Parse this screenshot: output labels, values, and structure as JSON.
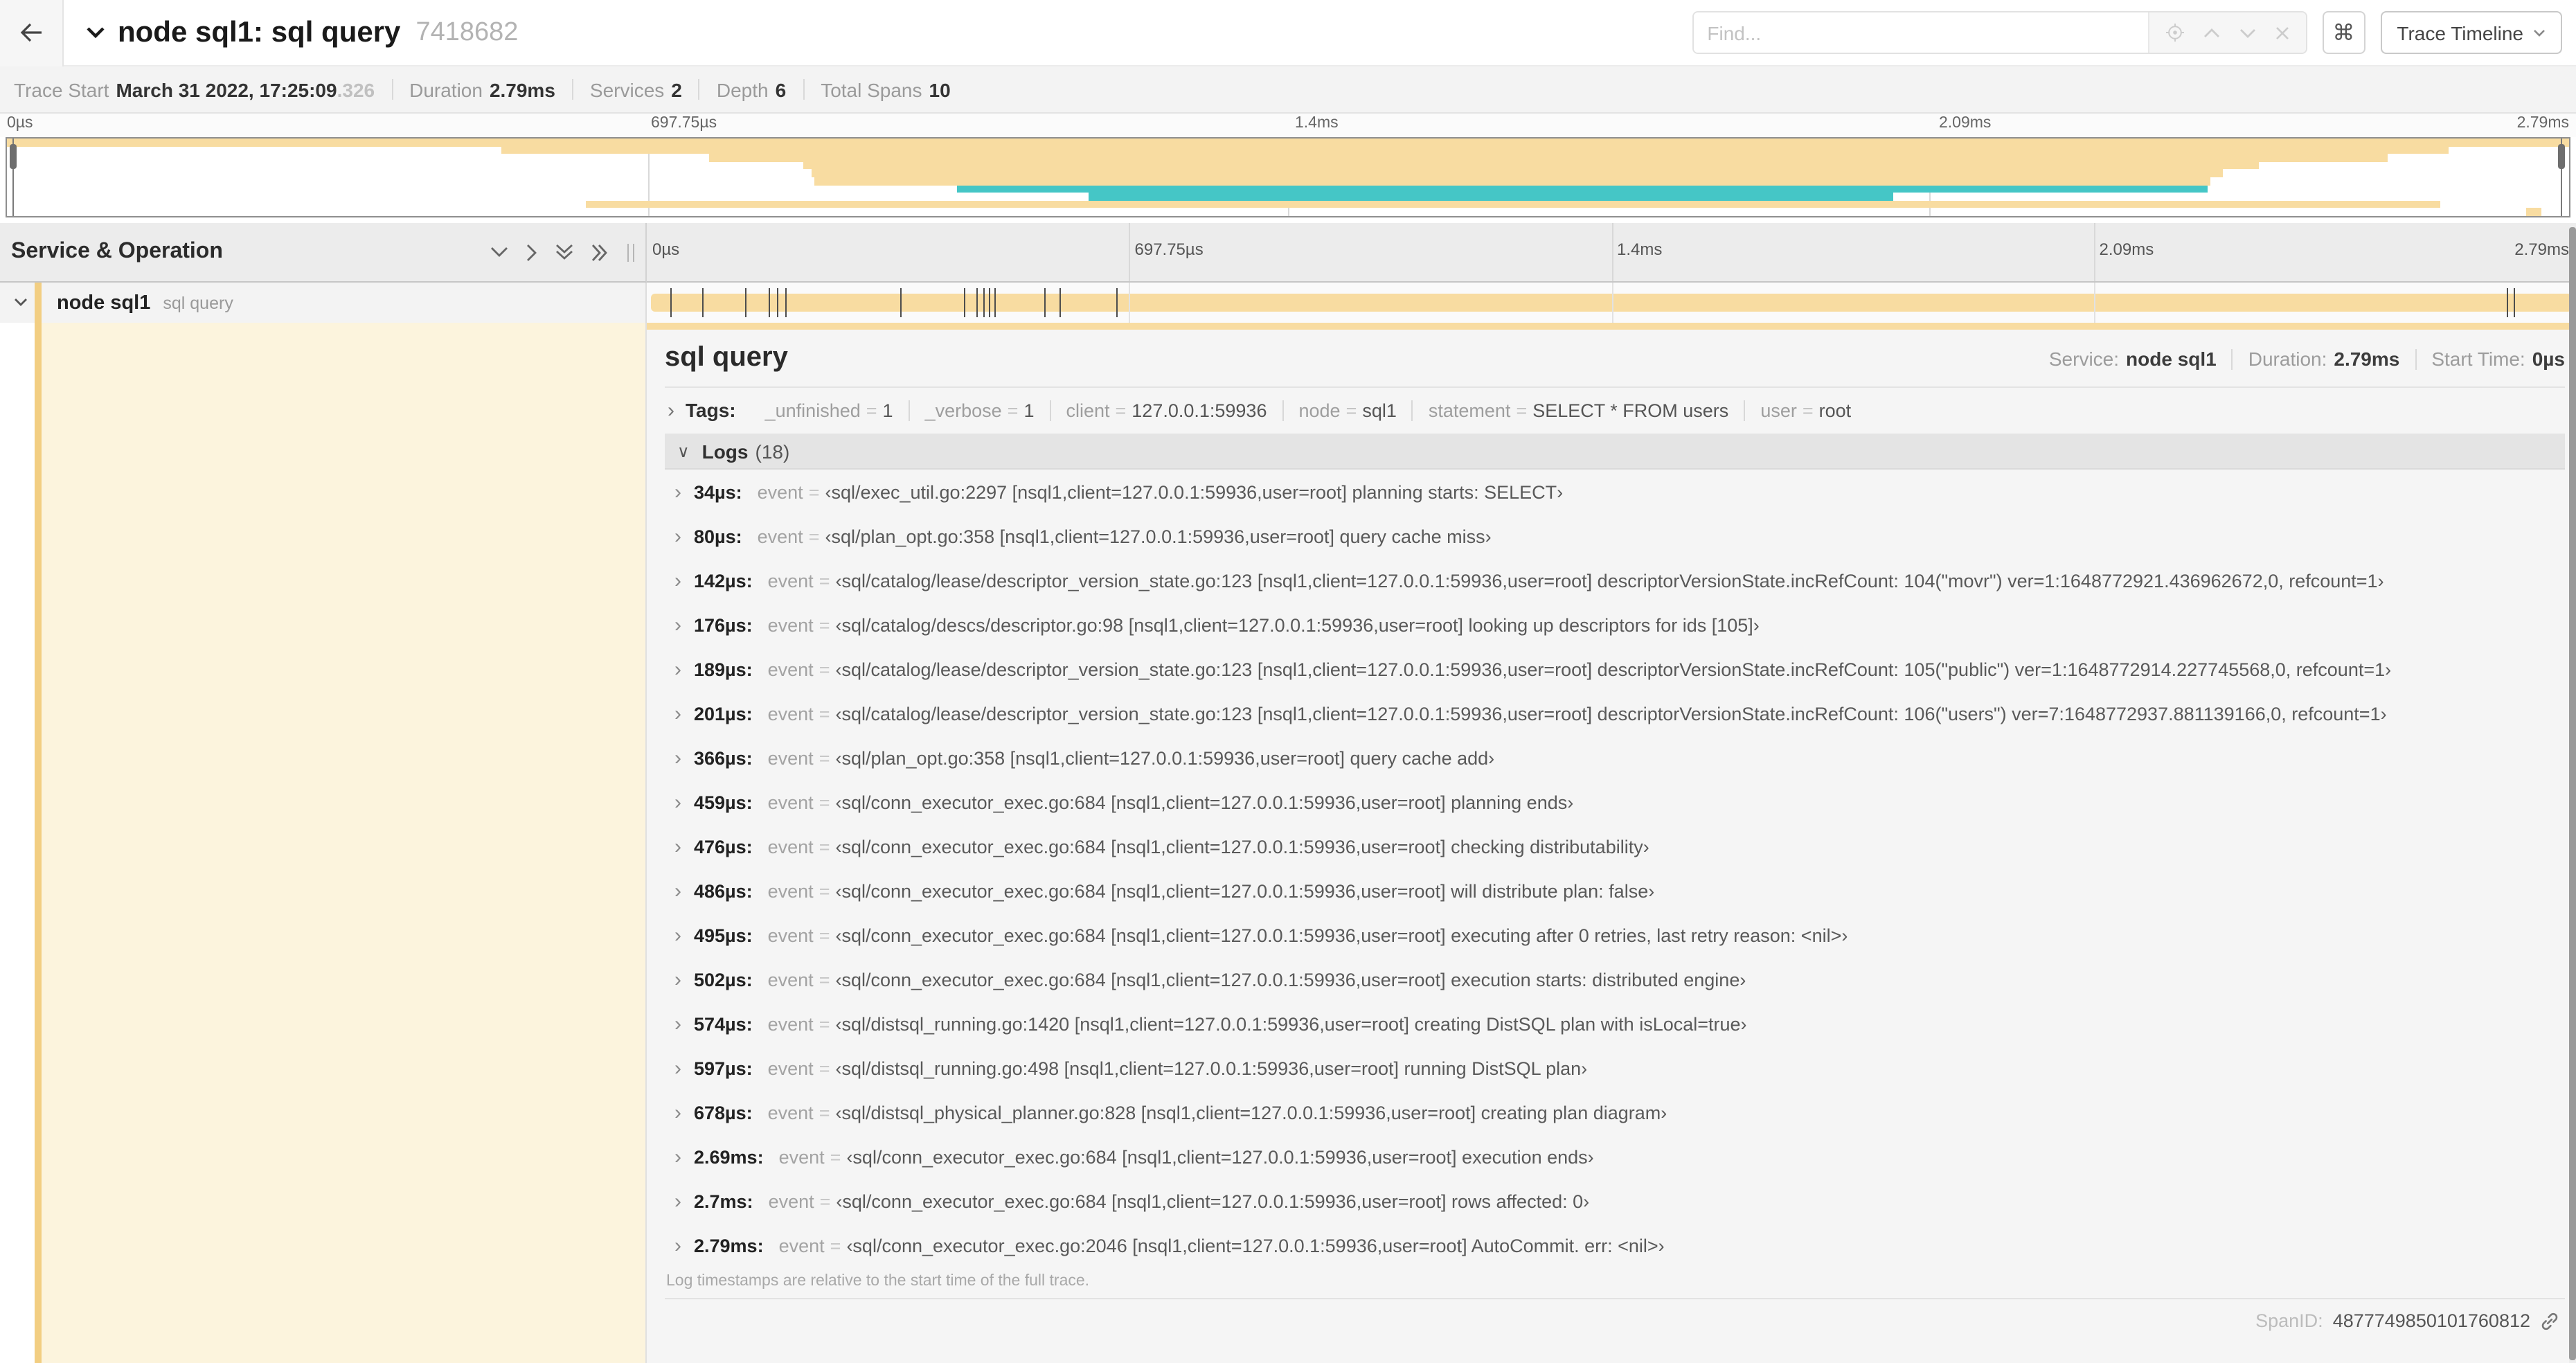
{
  "header": {
    "title": "node sql1: sql query",
    "trace_id_short": "7418682",
    "find_placeholder": "Find...",
    "view_selector": "Trace Timeline",
    "shortcut_key": "⌘"
  },
  "trace_info": {
    "items": [
      {
        "label": "Trace Start",
        "value": "March 31 2022, 17:25:09",
        "suffix": ".326"
      },
      {
        "label": "Duration",
        "value": "2.79ms"
      },
      {
        "label": "Services",
        "value": "2"
      },
      {
        "label": "Depth",
        "value": "6"
      },
      {
        "label": "Total Spans",
        "value": "10"
      }
    ]
  },
  "minimap": {
    "palette": {
      "orange": "#f8dca1",
      "teal": "#45c6c6"
    },
    "spans": [
      {
        "s": 0,
        "e": 100,
        "c": "orange"
      },
      {
        "s": 19.3,
        "e": 95.3,
        "c": "orange"
      },
      {
        "s": 27.4,
        "e": 92.9,
        "c": "orange"
      },
      {
        "s": 31.1,
        "e": 87.9,
        "c": "orange"
      },
      {
        "s": 31.4,
        "e": 86.5,
        "c": "orange"
      },
      {
        "s": 31.5,
        "e": 86.0,
        "c": "orange"
      },
      {
        "s": 37.1,
        "e": 85.9,
        "c": "teal"
      },
      {
        "s": 42.2,
        "e": 73.6,
        "c": "teal"
      },
      {
        "s": 22.6,
        "e": 95.0,
        "c": "orange"
      },
      {
        "s": 98.3,
        "e": 98.9,
        "c": "orange"
      }
    ]
  },
  "timeline": {
    "left_header": "Service & Operation",
    "ticks": [
      {
        "label": "0µs",
        "pos": 0
      },
      {
        "label": "697.75µs",
        "pos": 25
      },
      {
        "label": "1.4ms",
        "pos": 50
      },
      {
        "label": "2.09ms",
        "pos": 75
      },
      {
        "label": "2.79ms",
        "pos": 100
      }
    ],
    "gridline_positions": [
      25,
      50,
      75
    ],
    "row": {
      "service": "node sql1",
      "operation": "sql query"
    },
    "duration_us": 2790,
    "log_marker_times_us": [
      34,
      80,
      142,
      176,
      189,
      201,
      366,
      459,
      476,
      486,
      495,
      502,
      574,
      597,
      678,
      2690,
      2700
    ]
  },
  "detail": {
    "title": "sql query",
    "meta": [
      {
        "label": "Service:",
        "value": "node sql1"
      },
      {
        "label": "Duration:",
        "value": "2.79ms"
      },
      {
        "label": "Start Time:",
        "value": "0µs"
      }
    ],
    "tags_label": "Tags:",
    "tags": [
      {
        "key": "_unfinished",
        "value": "1"
      },
      {
        "key": "_verbose",
        "value": "1"
      },
      {
        "key": "client",
        "value": "127.0.0.1:59936"
      },
      {
        "key": "node",
        "value": "sql1"
      },
      {
        "key": "statement",
        "value": "SELECT * FROM users"
      },
      {
        "key": "user",
        "value": "root"
      }
    ],
    "logs_label": "Logs",
    "logs_count": "(18)",
    "logs": [
      {
        "time": "34µs:",
        "key": "event",
        "value": "‹sql/exec_util.go:2297 [nsql1,client=127.0.0.1:59936,user=root] planning starts: SELECT›"
      },
      {
        "time": "80µs:",
        "key": "event",
        "value": "‹sql/plan_opt.go:358 [nsql1,client=127.0.0.1:59936,user=root] query cache miss›"
      },
      {
        "time": "142µs:",
        "key": "event",
        "value": "‹sql/catalog/lease/descriptor_version_state.go:123 [nsql1,client=127.0.0.1:59936,user=root] descriptorVersionState.incRefCount: 104(\"movr\") ver=1:1648772921.436962672,0, refcount=1›"
      },
      {
        "time": "176µs:",
        "key": "event",
        "value": "‹sql/catalog/descs/descriptor.go:98 [nsql1,client=127.0.0.1:59936,user=root] looking up descriptors for ids [105]›"
      },
      {
        "time": "189µs:",
        "key": "event",
        "value": "‹sql/catalog/lease/descriptor_version_state.go:123 [nsql1,client=127.0.0.1:59936,user=root] descriptorVersionState.incRefCount: 105(\"public\") ver=1:1648772914.227745568,0, refcount=1›"
      },
      {
        "time": "201µs:",
        "key": "event",
        "value": "‹sql/catalog/lease/descriptor_version_state.go:123 [nsql1,client=127.0.0.1:59936,user=root] descriptorVersionState.incRefCount: 106(\"users\") ver=7:1648772937.881139166,0, refcount=1›"
      },
      {
        "time": "366µs:",
        "key": "event",
        "value": "‹sql/plan_opt.go:358 [nsql1,client=127.0.0.1:59936,user=root] query cache add›"
      },
      {
        "time": "459µs:",
        "key": "event",
        "value": "‹sql/conn_executor_exec.go:684 [nsql1,client=127.0.0.1:59936,user=root] planning ends›"
      },
      {
        "time": "476µs:",
        "key": "event",
        "value": "‹sql/conn_executor_exec.go:684 [nsql1,client=127.0.0.1:59936,user=root] checking distributability›"
      },
      {
        "time": "486µs:",
        "key": "event",
        "value": "‹sql/conn_executor_exec.go:684 [nsql1,client=127.0.0.1:59936,user=root] will distribute plan: false›"
      },
      {
        "time": "495µs:",
        "key": "event",
        "value": "‹sql/conn_executor_exec.go:684 [nsql1,client=127.0.0.1:59936,user=root] executing after 0 retries, last retry reason: <nil>›"
      },
      {
        "time": "502µs:",
        "key": "event",
        "value": "‹sql/conn_executor_exec.go:684 [nsql1,client=127.0.0.1:59936,user=root] execution starts: distributed engine›"
      },
      {
        "time": "574µs:",
        "key": "event",
        "value": "‹sql/distsql_running.go:1420 [nsql1,client=127.0.0.1:59936,user=root] creating DistSQL plan with isLocal=true›"
      },
      {
        "time": "597µs:",
        "key": "event",
        "value": "‹sql/distsql_running.go:498 [nsql1,client=127.0.0.1:59936,user=root] running DistSQL plan›"
      },
      {
        "time": "678µs:",
        "key": "event",
        "value": "‹sql/distsql_physical_planner.go:828 [nsql1,client=127.0.0.1:59936,user=root] creating plan diagram›"
      },
      {
        "time": "2.69ms:",
        "key": "event",
        "value": "‹sql/conn_executor_exec.go:684 [nsql1,client=127.0.0.1:59936,user=root] execution ends›"
      },
      {
        "time": "2.7ms:",
        "key": "event",
        "value": "‹sql/conn_executor_exec.go:684 [nsql1,client=127.0.0.1:59936,user=root] rows affected: 0›"
      },
      {
        "time": "2.79ms:",
        "key": "event",
        "value": "‹sql/conn_executor_exec.go:2046 [nsql1,client=127.0.0.1:59936,user=root] AutoCommit. err: <nil>›"
      }
    ],
    "logs_footnote": "Log timestamps are relative to the start time of the full trace.",
    "span_id_label": "SpanID:",
    "span_id": "4877749850101760812"
  }
}
